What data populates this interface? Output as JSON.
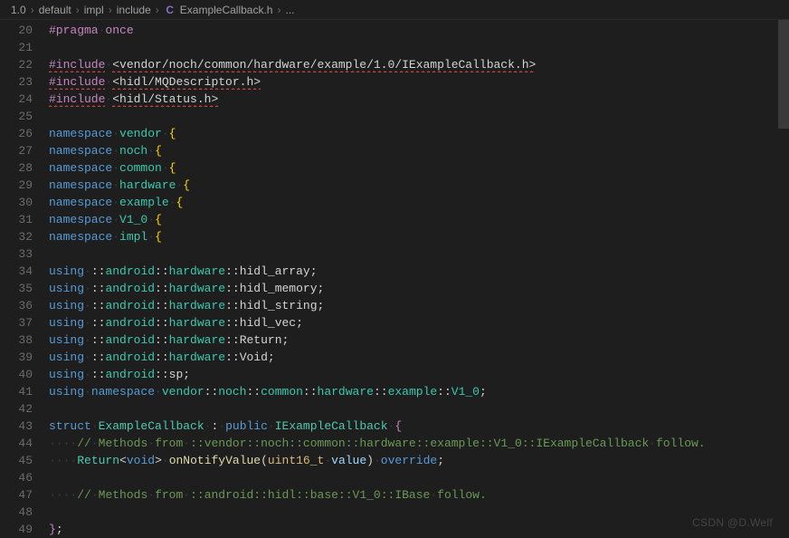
{
  "breadcrumb": {
    "parts": [
      "1.0",
      "default",
      "impl",
      "include"
    ],
    "file_icon": "C",
    "file": "ExampleCallback.h",
    "tail": "..."
  },
  "editor": {
    "first_line": 20,
    "lines": [
      [
        [
          "c-macro",
          "#pragma"
        ],
        [
          "c-ws",
          "·"
        ],
        [
          "c-macro",
          "once"
        ]
      ],
      [],
      [
        [
          "c-macro sq",
          "#include"
        ],
        [
          "c-ws",
          "·"
        ],
        [
          "c-incpath sq",
          "<vendor/noch/common/hardware/example/1.0/IExampleCallback.h>"
        ]
      ],
      [
        [
          "c-macro sq",
          "#include"
        ],
        [
          "c-ws",
          "·"
        ],
        [
          "c-incpath sq",
          "<hidl/MQDescriptor.h>"
        ]
      ],
      [
        [
          "c-macro sq",
          "#include"
        ],
        [
          "c-ws",
          "·"
        ],
        [
          "c-incpath sq",
          "<hidl/Status.h>"
        ]
      ],
      [],
      [
        [
          "c-keyword",
          "namespace"
        ],
        [
          "c-ws",
          "·"
        ],
        [
          "c-ns",
          "vendor"
        ],
        [
          "c-ws",
          "·"
        ],
        [
          "c-brace",
          "{"
        ]
      ],
      [
        [
          "c-keyword",
          "namespace"
        ],
        [
          "c-ws",
          "·"
        ],
        [
          "c-ns",
          "noch"
        ],
        [
          "c-ws",
          "·"
        ],
        [
          "c-brace",
          "{"
        ]
      ],
      [
        [
          "c-keyword",
          "namespace"
        ],
        [
          "c-ws",
          "·"
        ],
        [
          "c-ns",
          "common"
        ],
        [
          "c-ws",
          "·"
        ],
        [
          "c-brace",
          "{"
        ]
      ],
      [
        [
          "c-keyword",
          "namespace"
        ],
        [
          "c-ws",
          "·"
        ],
        [
          "c-ns",
          "hardware"
        ],
        [
          "c-ws",
          "·"
        ],
        [
          "c-brace",
          "{"
        ]
      ],
      [
        [
          "c-keyword",
          "namespace"
        ],
        [
          "c-ws",
          "·"
        ],
        [
          "c-ns",
          "example"
        ],
        [
          "c-ws",
          "·"
        ],
        [
          "c-brace",
          "{"
        ]
      ],
      [
        [
          "c-keyword",
          "namespace"
        ],
        [
          "c-ws",
          "·"
        ],
        [
          "c-ns",
          "V1_0"
        ],
        [
          "c-ws",
          "·"
        ],
        [
          "c-brace",
          "{"
        ]
      ],
      [
        [
          "c-keyword",
          "namespace"
        ],
        [
          "c-ws",
          "·"
        ],
        [
          "c-ns",
          "impl"
        ],
        [
          "c-ws",
          "·"
        ],
        [
          "c-brace",
          "{"
        ]
      ],
      [],
      [
        [
          "c-keyword",
          "using"
        ],
        [
          "c-ws",
          "·"
        ],
        [
          "c-punc",
          "::"
        ],
        [
          "c-ns",
          "android"
        ],
        [
          "c-punc",
          "::"
        ],
        [
          "c-ns",
          "hardware"
        ],
        [
          "c-punc",
          "::"
        ],
        [
          "c-white",
          "hidl_array"
        ],
        [
          "c-punc",
          ";"
        ]
      ],
      [
        [
          "c-keyword",
          "using"
        ],
        [
          "c-ws",
          "·"
        ],
        [
          "c-punc",
          "::"
        ],
        [
          "c-ns",
          "android"
        ],
        [
          "c-punc",
          "::"
        ],
        [
          "c-ns",
          "hardware"
        ],
        [
          "c-punc",
          "::"
        ],
        [
          "c-white",
          "hidl_memory"
        ],
        [
          "c-punc",
          ";"
        ]
      ],
      [
        [
          "c-keyword",
          "using"
        ],
        [
          "c-ws",
          "·"
        ],
        [
          "c-punc",
          "::"
        ],
        [
          "c-ns",
          "android"
        ],
        [
          "c-punc",
          "::"
        ],
        [
          "c-ns",
          "hardware"
        ],
        [
          "c-punc",
          "::"
        ],
        [
          "c-white",
          "hidl_string"
        ],
        [
          "c-punc",
          ";"
        ]
      ],
      [
        [
          "c-keyword",
          "using"
        ],
        [
          "c-ws",
          "·"
        ],
        [
          "c-punc",
          "::"
        ],
        [
          "c-ns",
          "android"
        ],
        [
          "c-punc",
          "::"
        ],
        [
          "c-ns",
          "hardware"
        ],
        [
          "c-punc",
          "::"
        ],
        [
          "c-white",
          "hidl_vec"
        ],
        [
          "c-punc",
          ";"
        ]
      ],
      [
        [
          "c-keyword",
          "using"
        ],
        [
          "c-ws",
          "·"
        ],
        [
          "c-punc",
          "::"
        ],
        [
          "c-ns",
          "android"
        ],
        [
          "c-punc",
          "::"
        ],
        [
          "c-ns",
          "hardware"
        ],
        [
          "c-punc",
          "::"
        ],
        [
          "c-white",
          "Return"
        ],
        [
          "c-punc",
          ";"
        ]
      ],
      [
        [
          "c-keyword",
          "using"
        ],
        [
          "c-ws",
          "·"
        ],
        [
          "c-punc",
          "::"
        ],
        [
          "c-ns",
          "android"
        ],
        [
          "c-punc",
          "::"
        ],
        [
          "c-ns",
          "hardware"
        ],
        [
          "c-punc",
          "::"
        ],
        [
          "c-white",
          "Void"
        ],
        [
          "c-punc",
          ";"
        ]
      ],
      [
        [
          "c-keyword",
          "using"
        ],
        [
          "c-ws",
          "·"
        ],
        [
          "c-punc",
          "::"
        ],
        [
          "c-ns",
          "android"
        ],
        [
          "c-punc",
          "::"
        ],
        [
          "c-white",
          "sp"
        ],
        [
          "c-punc",
          ";"
        ]
      ],
      [
        [
          "c-keyword",
          "using"
        ],
        [
          "c-ws",
          "·"
        ],
        [
          "c-keyword",
          "namespace"
        ],
        [
          "c-ws",
          "·"
        ],
        [
          "c-ns",
          "vendor"
        ],
        [
          "c-punc",
          "::"
        ],
        [
          "c-ns",
          "noch"
        ],
        [
          "c-punc",
          "::"
        ],
        [
          "c-ns",
          "common"
        ],
        [
          "c-punc",
          "::"
        ],
        [
          "c-ns",
          "hardware"
        ],
        [
          "c-punc",
          "::"
        ],
        [
          "c-ns",
          "example"
        ],
        [
          "c-punc",
          "::"
        ],
        [
          "c-ns",
          "V1_0"
        ],
        [
          "c-punc",
          ";"
        ]
      ],
      [],
      [
        [
          "c-keyword",
          "struct"
        ],
        [
          "c-ws",
          "·"
        ],
        [
          "c-type",
          "ExampleCallback"
        ],
        [
          "c-ws",
          "·"
        ],
        [
          "c-punc",
          ":"
        ],
        [
          "c-ws",
          "·"
        ],
        [
          "c-keyword",
          "public"
        ],
        [
          "c-ws",
          "·"
        ],
        [
          "c-type",
          "IExampleCallback"
        ],
        [
          "c-ws",
          "·"
        ],
        [
          "c-braceP",
          "{"
        ]
      ],
      [
        [
          "c-ws",
          "····"
        ],
        [
          "c-comment",
          "//"
        ],
        [
          "c-ws",
          "·"
        ],
        [
          "c-comment",
          "Methods"
        ],
        [
          "c-ws",
          "·"
        ],
        [
          "c-comment",
          "from"
        ],
        [
          "c-ws",
          "·"
        ],
        [
          "c-comment",
          "::vendor::noch::common::hardware::example::V1_0::IExampleCallback"
        ],
        [
          "c-ws",
          "·"
        ],
        [
          "c-comment",
          "follow."
        ]
      ],
      [
        [
          "c-ws",
          "····"
        ],
        [
          "c-type",
          "Return"
        ],
        [
          "c-punc",
          "<"
        ],
        [
          "c-keyword",
          "void"
        ],
        [
          "c-punc",
          ">"
        ],
        [
          "c-ws",
          "·"
        ],
        [
          "c-func",
          "onNotifyValue"
        ],
        [
          "c-punc",
          "("
        ],
        [
          "c-typeY",
          "uint16_t"
        ],
        [
          "c-ws",
          "·"
        ],
        [
          "c-param",
          "value"
        ],
        [
          "c-punc",
          ")"
        ],
        [
          "c-ws",
          "·"
        ],
        [
          "c-keyword",
          "override"
        ],
        [
          "c-punc",
          ";"
        ]
      ],
      [],
      [
        [
          "c-ws",
          "····"
        ],
        [
          "c-comment",
          "//"
        ],
        [
          "c-ws",
          "·"
        ],
        [
          "c-comment",
          "Methods"
        ],
        [
          "c-ws",
          "·"
        ],
        [
          "c-comment",
          "from"
        ],
        [
          "c-ws",
          "·"
        ],
        [
          "c-comment",
          "::android::hidl::base::V1_0::IBase"
        ],
        [
          "c-ws",
          "·"
        ],
        [
          "c-comment",
          "follow."
        ]
      ],
      [],
      [
        [
          "c-braceP",
          "}"
        ],
        [
          "c-punc",
          ";"
        ]
      ]
    ]
  },
  "watermark": "CSDN @D.Welf"
}
